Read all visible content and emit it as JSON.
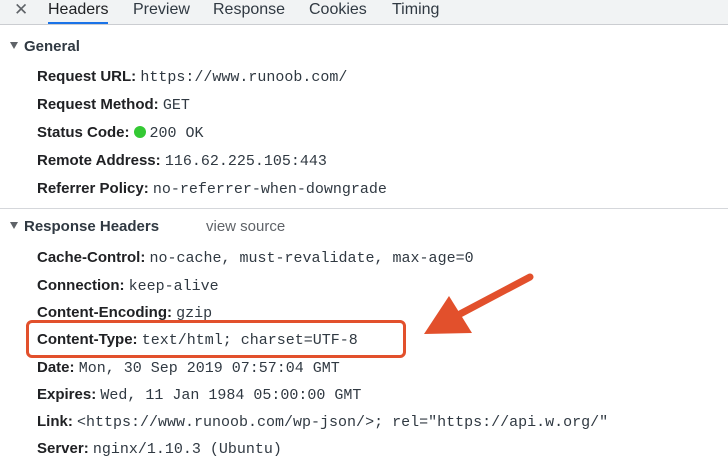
{
  "tabs": {
    "close_glyph": "✕",
    "items": [
      "Headers",
      "Preview",
      "Response",
      "Cookies",
      "Timing"
    ],
    "active": "Headers"
  },
  "general": {
    "title": "General",
    "rows": [
      {
        "key": "Request URL:",
        "value": "https://www.runoob.com/"
      },
      {
        "key": "Request Method:",
        "value": "GET"
      },
      {
        "key": "Status Code:",
        "value": "200 OK"
      },
      {
        "key": "Remote Address:",
        "value": "116.62.225.105:443"
      },
      {
        "key": "Referrer Policy:",
        "value": "no-referrer-when-downgrade"
      }
    ]
  },
  "response_headers": {
    "title": "Response Headers",
    "view_source": "view source",
    "rows": [
      {
        "key": "Cache-Control:",
        "value": "no-cache, must-revalidate, max-age=0"
      },
      {
        "key": "Connection:",
        "value": "keep-alive"
      },
      {
        "key": "Content-Encoding:",
        "value": "gzip"
      },
      {
        "key": "Content-Type:",
        "value": "text/html; charset=UTF-8"
      },
      {
        "key": "Date:",
        "value": "Mon, 30 Sep 2019 07:57:04 GMT"
      },
      {
        "key": "Expires:",
        "value": "Wed, 11 Jan 1984 05:00:00 GMT"
      },
      {
        "key": "Link:",
        "value": "<https://www.runoob.com/wp-json/>; rel=\"https://api.w.org/\""
      },
      {
        "key": "Server:",
        "value": "nginx/1.10.3 (Ubuntu)"
      }
    ]
  },
  "colors": {
    "status_ok": "#34c934",
    "annotation": "#e2502c",
    "tab_accent": "#1a73e8"
  },
  "icons": {
    "close": "close-icon",
    "status": "status-dot-icon",
    "collapse": "triangle-down-icon",
    "annotation": "arrow-icon"
  }
}
